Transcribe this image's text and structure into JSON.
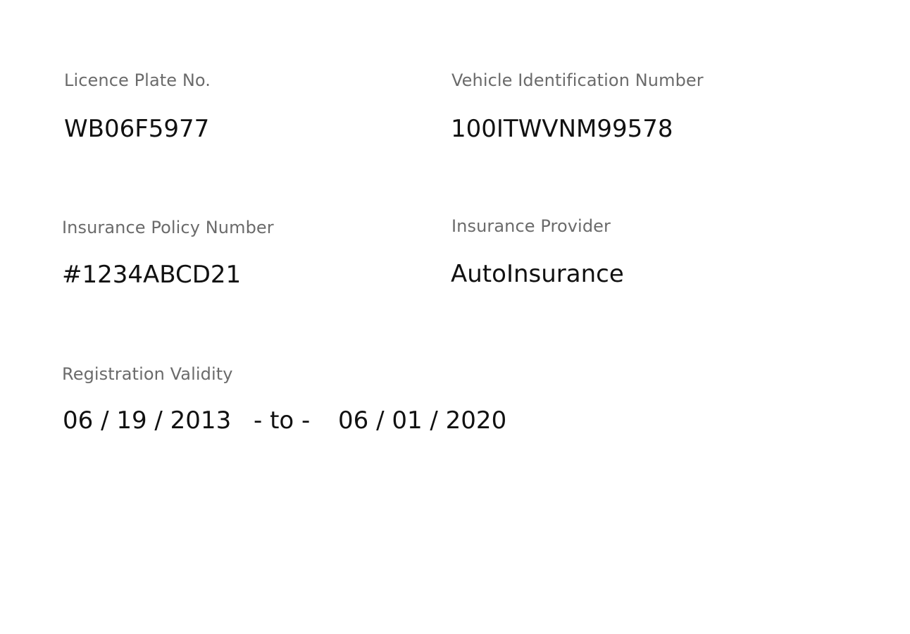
{
  "licence_plate": {
    "label": "Licence Plate No.",
    "value": "WB06F5977"
  },
  "vin": {
    "label": "Vehicle Identification Number",
    "value": "100ITWVNM99578"
  },
  "insurance_policy": {
    "label": "Insurance Policy Number",
    "value": "#1234ABCD21"
  },
  "insurance_provider": {
    "label": "Insurance Provider",
    "value": "AutoInsurance"
  },
  "registration_validity": {
    "label": "Registration Validity",
    "from": "06 / 19 / 2013",
    "separator": "- to -",
    "to": "06 / 01 / 2020"
  },
  "colors": {
    "label": "#6b6b6b",
    "value": "#111111",
    "background": "#ffffff"
  }
}
